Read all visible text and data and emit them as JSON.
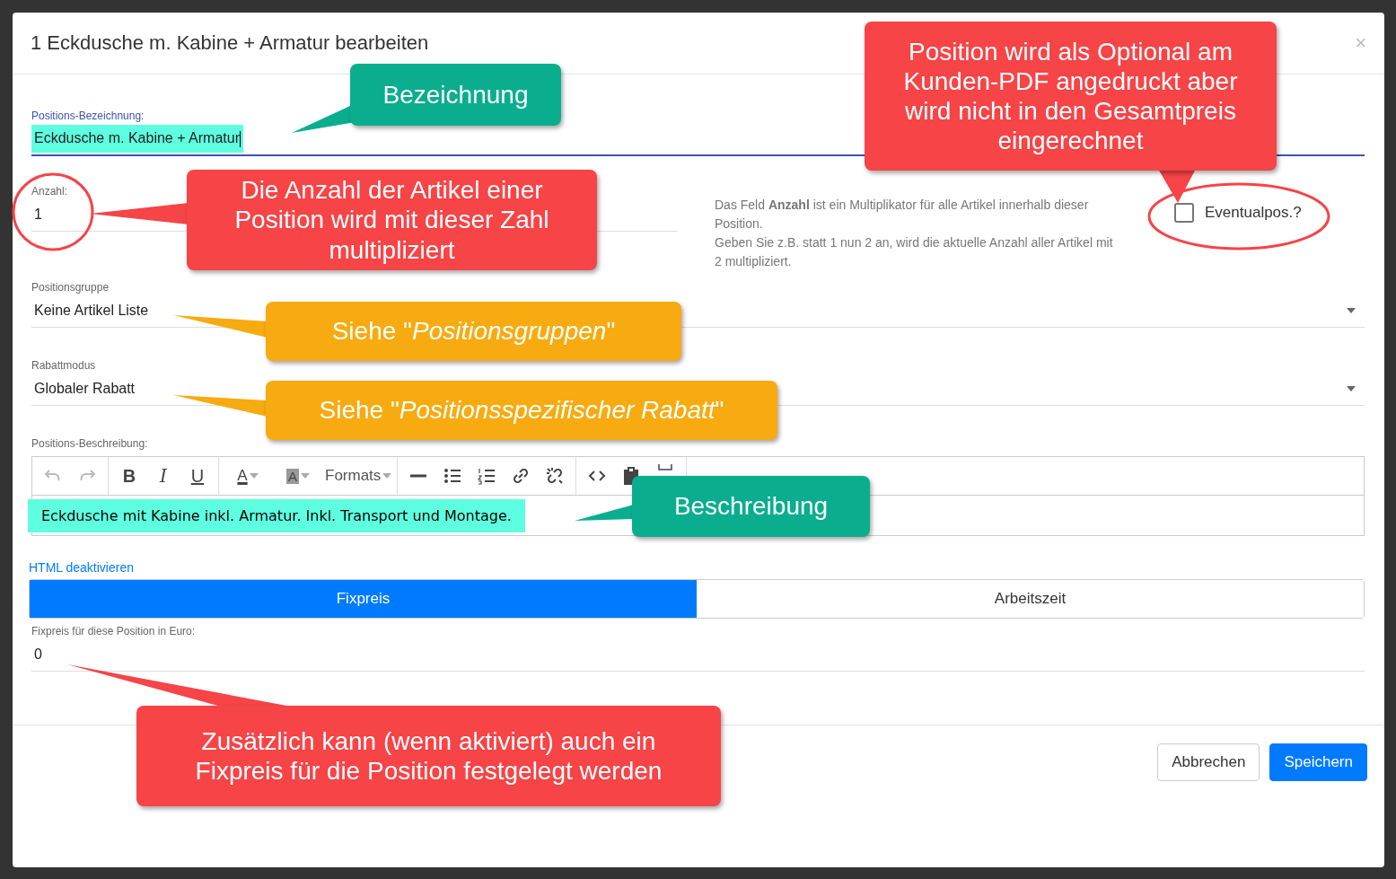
{
  "dialog": {
    "title": "1 Eckdusche m. Kabine + Armatur bearbeiten",
    "close": "×"
  },
  "name_field": {
    "label": "Positions-Bezeichnung:",
    "value": "Eckdusche m. Kabine + Armatur",
    "focused": true,
    "highlighted": true
  },
  "quantity_field": {
    "label": "Anzahl:",
    "value": "1"
  },
  "quantity_help": [
    "Das Feld **Anzahl** ist ein Multiplikator für alle Artikel innerhalb dieser Position.",
    "Geben Sie z.B. statt 1 nun 2 an, wird die aktuelle Anzahl aller Artikel mit 2 multipliziert."
  ],
  "optional_checkbox": {
    "label": "Eventualpos.?",
    "checked": false
  },
  "group_select": {
    "label": "Positionsgruppe",
    "value": "Keine Artikel Liste"
  },
  "discount_select": {
    "label": "Rabattmodus",
    "value": "Globaler Rabatt"
  },
  "description": {
    "label": "Positions-Beschreibung:",
    "text": "Eckdusche mit Kabine inkl. Armatur. Inkl. Transport und Montage.",
    "highlighted": true,
    "toolbar": [
      [
        {
          "kind": "undo",
          "disabled": true
        },
        {
          "kind": "redo",
          "disabled": true
        }
      ],
      [
        {
          "kind": "bold",
          "label": "B"
        },
        {
          "kind": "italic",
          "label": "I"
        },
        {
          "kind": "underline",
          "label": "U"
        }
      ],
      [
        {
          "kind": "textcolor",
          "label": "A"
        },
        {
          "kind": "bgcolor",
          "label": "A"
        },
        {
          "kind": "formats",
          "label": "Formats"
        }
      ],
      [
        {
          "kind": "hr"
        },
        {
          "kind": "bullist"
        },
        {
          "kind": "numlist"
        },
        {
          "kind": "link"
        },
        {
          "kind": "unlink"
        }
      ],
      [
        {
          "kind": "code"
        },
        {
          "kind": "paste"
        },
        {
          "kind": "box"
        }
      ]
    ]
  },
  "html_link": "HTML deaktivieren",
  "price_tabs": [
    {
      "label": "Fixpreis",
      "selected": true
    },
    {
      "label": "Arbeitszeit",
      "selected": false
    }
  ],
  "fixed_price_field": {
    "label": "Fixpreis für diese Position in Euro:",
    "value": "0"
  },
  "buttons": [
    {
      "label": "Abbrechen",
      "kind": "secondary"
    },
    {
      "label": "Speichern",
      "kind": "primary"
    }
  ],
  "annotations": [
    {
      "text": "Bezeichnung",
      "color": "#0aae8f"
    },
    {
      "text": "Die Anzahl der Artikel einer Position wird mit dieser Zahl multipliziert",
      "color": "#f64447"
    },
    {
      "text": "Position wird als Optional am Kunden-PDF angedruckt aber wird nicht in den Gesamtpreis eingerechnet",
      "color": "#f64447"
    },
    {
      "text": "Siehe \"*Positionsgruppen*\"",
      "color": "#f7ab10"
    },
    {
      "text": "Siehe \"*Positionsspezifischer Rabatt*\"",
      "color": "#f7ab10"
    },
    {
      "text": "Beschreibung",
      "color": "#0aae8f"
    },
    {
      "text": "Zusätzlich kann (wenn aktiviert) auch ein Fixpreis für die Position festgelegt werden",
      "color": "#f64447"
    }
  ]
}
